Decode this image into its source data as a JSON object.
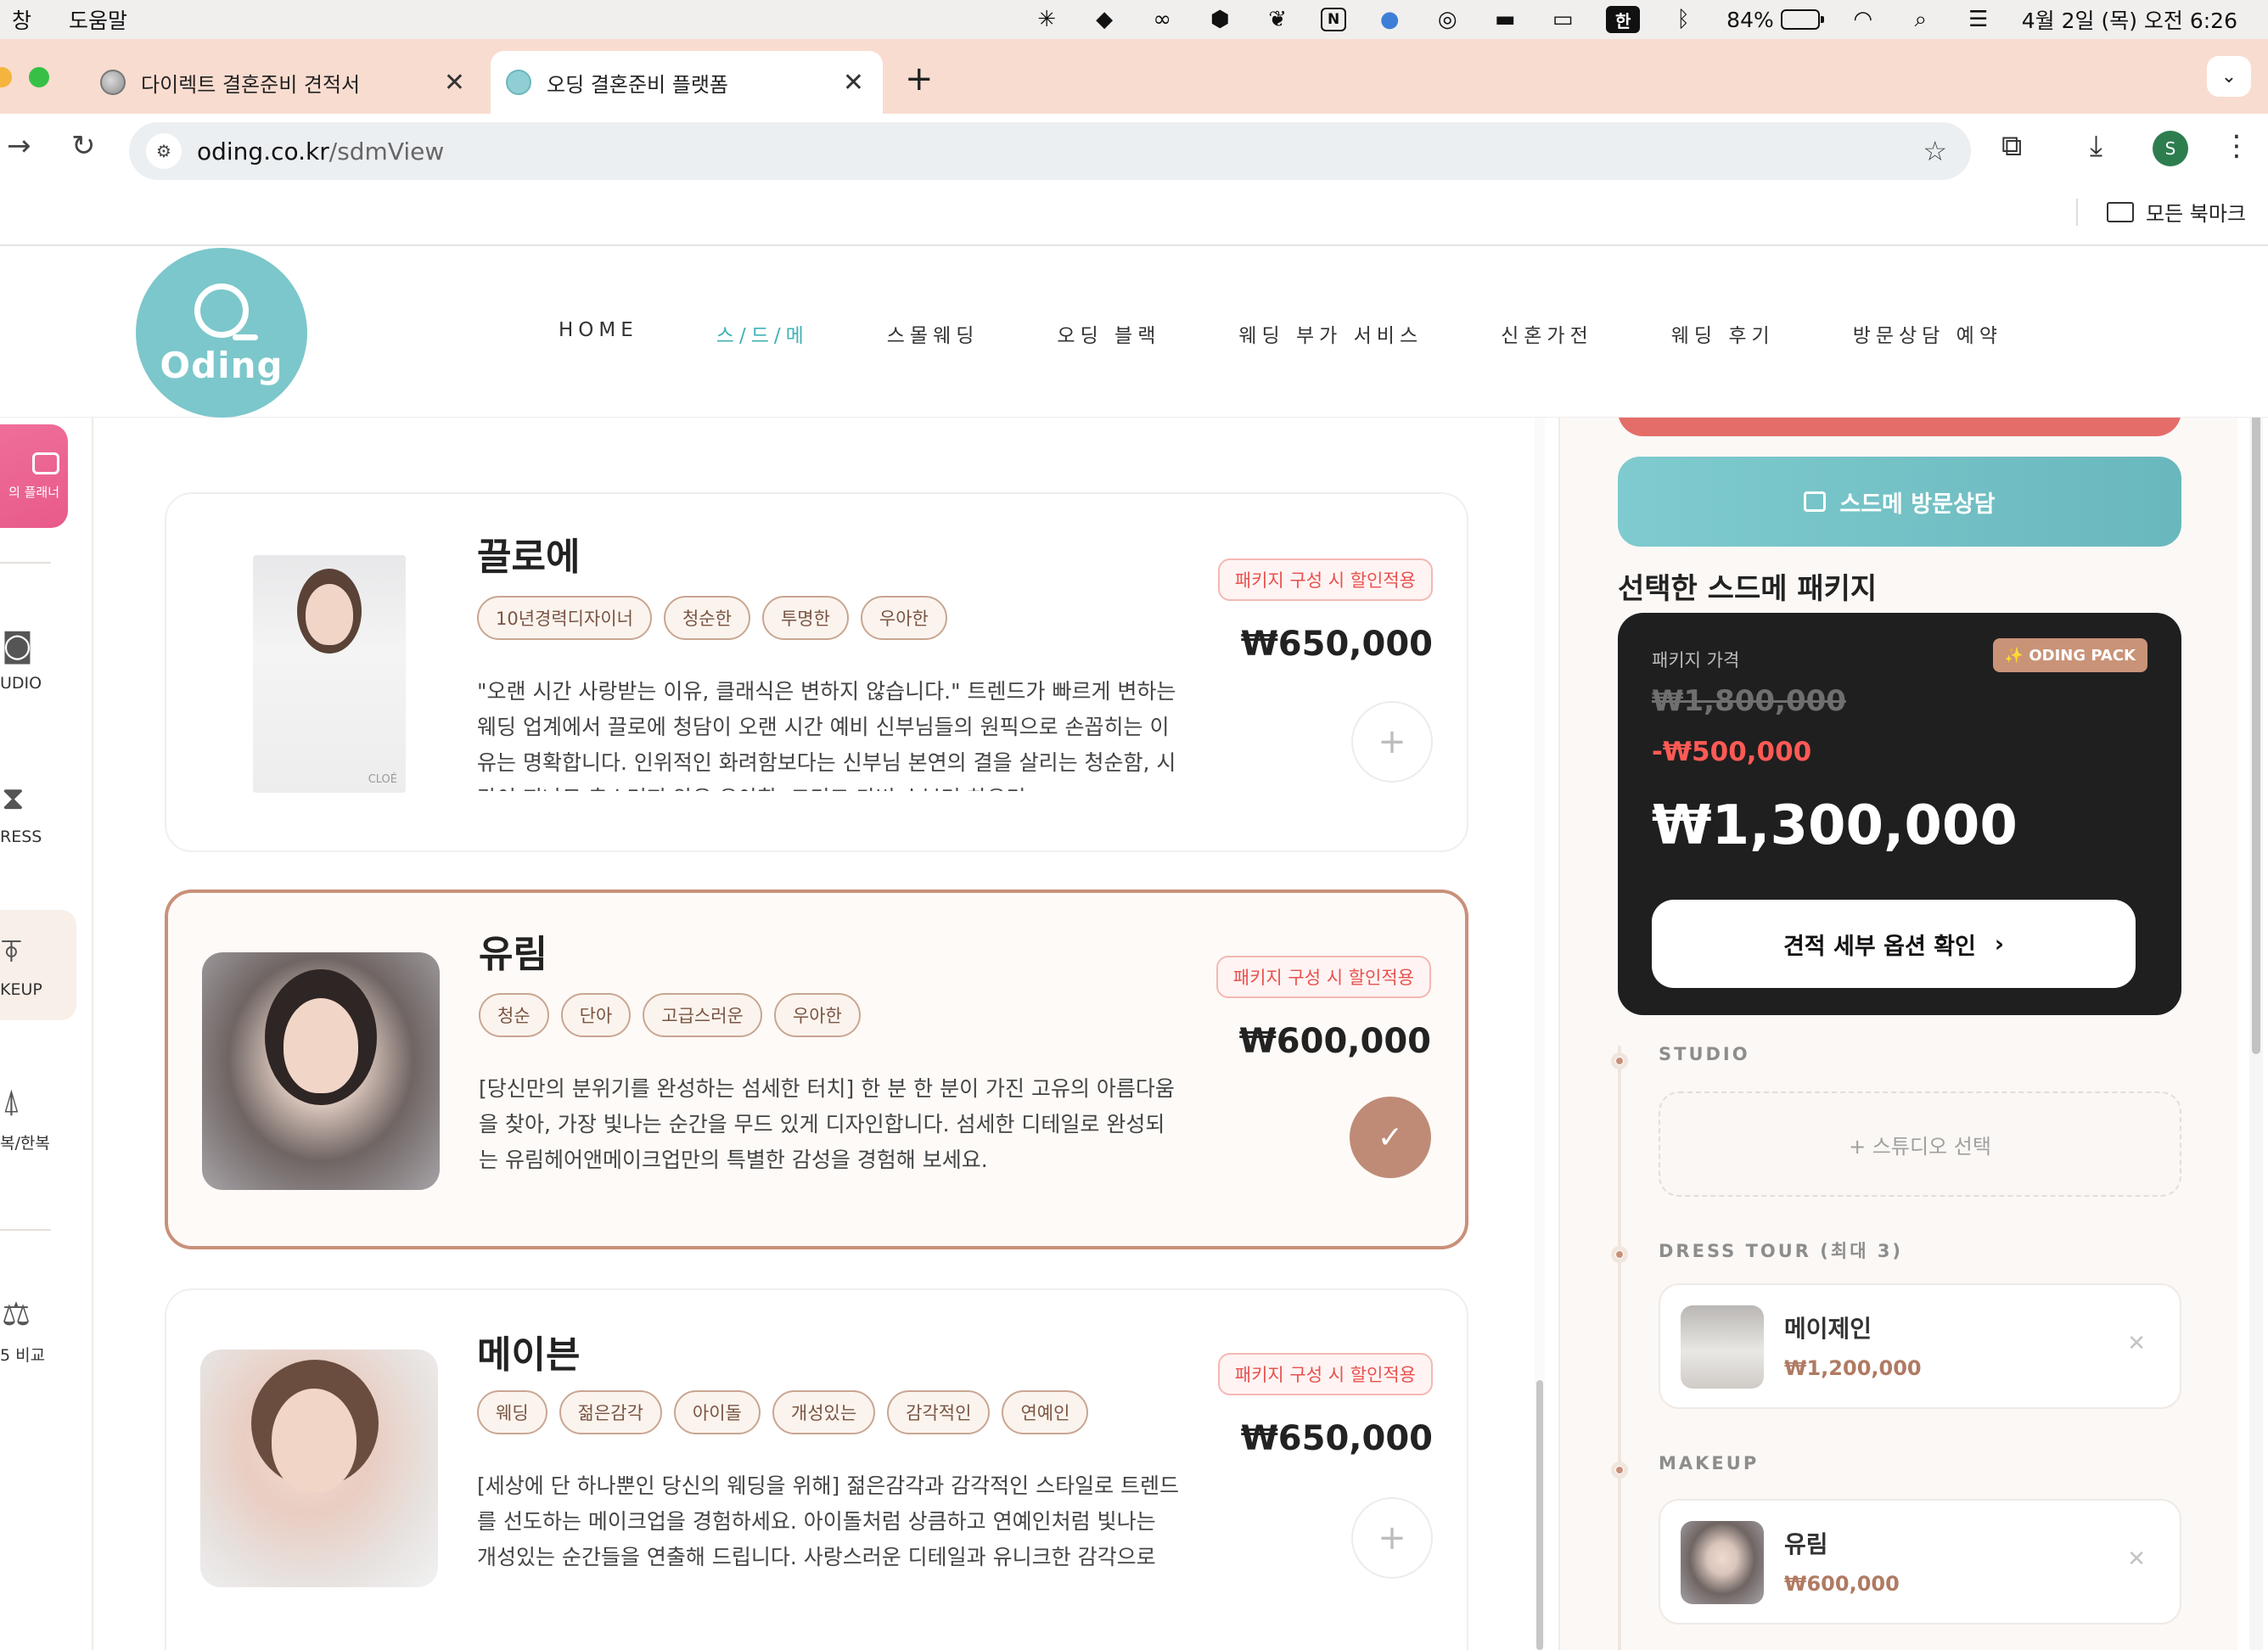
{
  "menubar": {
    "left": [
      "창",
      "도움말"
    ],
    "battery": "84%",
    "ime": "한",
    "clock": "4월 2일 (목) 오전 6:26",
    "icons": [
      "perplexity-icon",
      "app-icon",
      "creative-cloud-icon",
      "app-icon",
      "app-icon",
      "notion-icon",
      "app-icon",
      "airdrop-icon",
      "bed-icon",
      "display-icon",
      "bluetooth-icon",
      "wifi-icon",
      "search-icon",
      "control-center-icon"
    ]
  },
  "tabs": [
    {
      "title": "다이렉트 결혼준비 견적서",
      "icon": "globe-icon"
    },
    {
      "title": "오딩 결혼준비 플랫폼",
      "icon": "oding-favicon"
    }
  ],
  "address": {
    "host": "oding.co.kr",
    "path": "/sdmView"
  },
  "profile_initial": "S",
  "bookmarks": {
    "all": "모든 북마크"
  },
  "site": {
    "logo_text": "Oding",
    "nav": [
      "HOME",
      "스/드/메",
      "스몰웨딩",
      "오딩 블랙",
      "웨딩 부가 서비스",
      "신혼가전",
      "웨딩 후기",
      "방문상담 예약"
    ],
    "nav_active": "스/드/메",
    "accent": "#7cc7cb"
  },
  "rail": {
    "planner": "의 플래너",
    "items": [
      "UDIO",
      "RESS",
      "KEUP",
      "복/한복",
      "5 비교"
    ]
  },
  "cards": [
    {
      "name": "끌로에",
      "tags": [
        "10년경력디자이너",
        "청순한",
        "투명한",
        "우아한"
      ],
      "badge": "패키지 구성 시 할인적용",
      "price": "₩650,000",
      "photo_text": "CLOÉ",
      "desc": "\"오랜 시간 사랑받는 이유, 클래식은 변하지 않습니다.\" 트렌드가 빠르게 변하는 웨딩 업계에서 끌로에 청담이 오랜 시간 예비 신부님들의 원픽으로 손꼽히는 이유는 명확합니다. 인위적인 화려함보다는 신부님 본연의 결을 살리는 청순함, 시간이 지나도 촌스러지 않은 우아함, 그리고 가벼 수부터 하우리"
    },
    {
      "name": "유림",
      "tags": [
        "청순",
        "단아",
        "고급스러운",
        "우아한"
      ],
      "badge": "패키지 구성 시 할인적용",
      "price": "₩600,000",
      "desc": "[당신만의 분위기를 완성하는 섬세한 터치] 한 분 한 분이 가진 고유의 아름다움을 찾아, 가장 빛나는 순간을 무드 있게 디자인합니다. 섬세한 디테일로 완성되는 유림헤어앤메이크업만의 특별한 감성을 경험해 보세요."
    },
    {
      "name": "메이븐",
      "tags": [
        "웨딩",
        "젊은감각",
        "아이돌",
        "개성있는",
        "감각적인",
        "연예인"
      ],
      "badge": "패키지 구성 시 할인적용",
      "price": "₩650,000",
      "desc": "[세상에 단 하나뿐인 당신의 웨딩을 위해] 젊은감각과 감각적인 스타일로 트렌드를 선도하는 메이크업을 경험하세요. 아이돌처럼 상큼하고 연예인처럼 빛나는 개성있는 순간들을 연출해 드립니다. 사랑스러운 디테일과 유니크한 감각으로 모두의 기억에 남을 끝장을 웨딩을 선물합니다."
    }
  ],
  "panel": {
    "consult_label": "스드메 방문상담",
    "title": "선택한 스드메 패키지",
    "pack_label": "패키지 가격",
    "pack_tag": "✨ ODING PACK",
    "original": "₩1,800,000",
    "discount": "-₩500,000",
    "total": "₩1,300,000",
    "detail_label": "견적 세부 옵션 확인",
    "studio_label": "STUDIO",
    "studio_select": "+ 스튜디오 선택",
    "dress_label": "DRESS TOUR (최대 3)",
    "makeup_label": "MAKEUP",
    "dress_item": {
      "name": "메이제인",
      "price": "₩1,200,000"
    },
    "makeup_item": {
      "name": "유림",
      "price": "₩600,000"
    }
  }
}
